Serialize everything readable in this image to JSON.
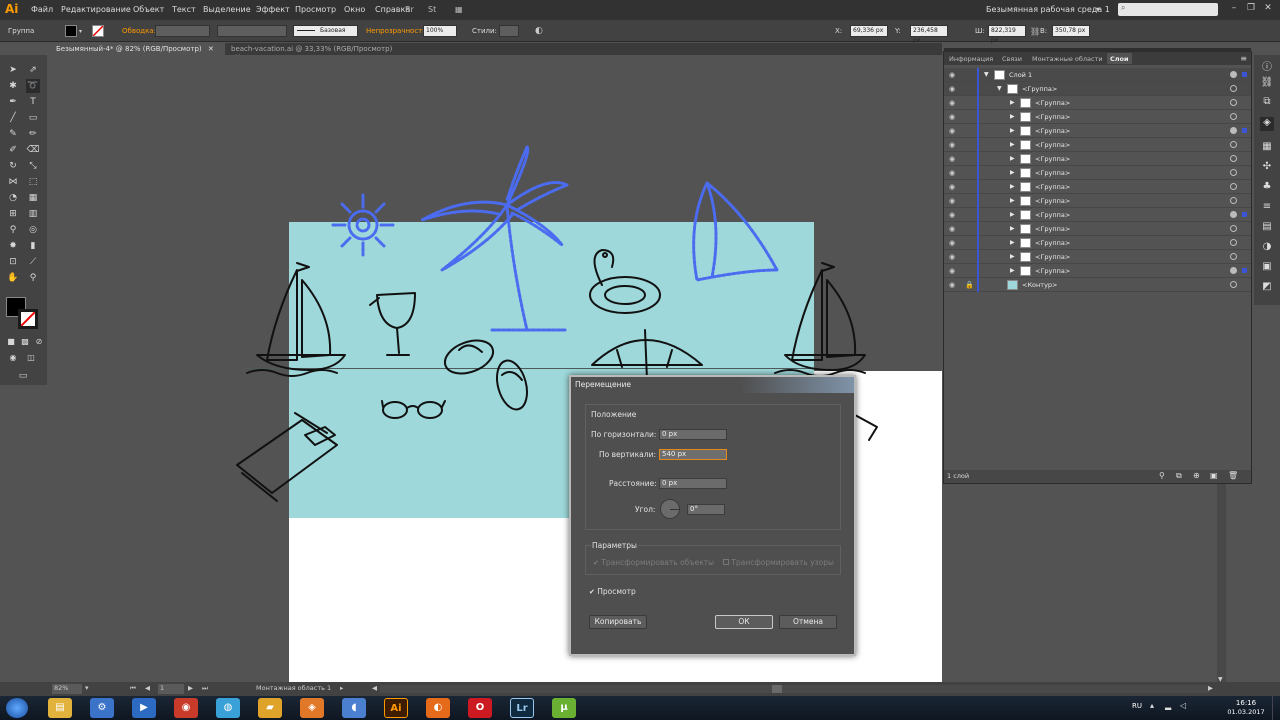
{
  "menubar": {
    "logo": "Ai",
    "items": [
      "Файл",
      "Редактирование",
      "Объект",
      "Текст",
      "Выделение",
      "Эффект",
      "Просмотр",
      "Окно",
      "Справка"
    ],
    "workspace": "Безымянная рабочая среда 1"
  },
  "controlbar": {
    "selection_label": "Группа",
    "stroke_label": "Обводка:",
    "stroke_style": "Базовая",
    "opacity_label": "Непрозрачность:",
    "opacity_value": "100%",
    "styles_label": "Стили:",
    "x_label": "X:",
    "x_value": "69,336 px",
    "y_label": "Y:",
    "y_value": "236,458 px",
    "w_label": "Ш:",
    "w_value": "822,319 px",
    "h_label": "В:",
    "h_value": "350,78 px"
  },
  "tabs": [
    {
      "label": "Безымянный-4* @ 82% (RGB/Просмотр)",
      "active": true
    },
    {
      "label": "beach-vacation.ai @ 33,33% (RGB/Просмотр)",
      "active": false
    }
  ],
  "layers_panel": {
    "tabs": [
      "Информация",
      "Связи",
      "Монтажные области",
      "Слои"
    ],
    "active_tab": "Слои",
    "rows": [
      {
        "label": "Слой 1",
        "indent": 0,
        "expanded": true,
        "target": "filled"
      },
      {
        "label": "<Группа>",
        "indent": 1,
        "expanded": true,
        "target": "ring"
      },
      {
        "label": "<Группа>",
        "indent": 2,
        "target": "ring"
      },
      {
        "label": "<Группа>",
        "indent": 2,
        "target": "ring"
      },
      {
        "label": "<Группа>",
        "indent": 2,
        "target": "filled"
      },
      {
        "label": "<Группа>",
        "indent": 2,
        "target": "ring"
      },
      {
        "label": "<Группа>",
        "indent": 2,
        "target": "ring"
      },
      {
        "label": "<Группа>",
        "indent": 2,
        "target": "ring"
      },
      {
        "label": "<Группа>",
        "indent": 2,
        "target": "ring"
      },
      {
        "label": "<Группа>",
        "indent": 2,
        "target": "ring"
      },
      {
        "label": "<Группа>",
        "indent": 2,
        "target": "filled"
      },
      {
        "label": "<Группа>",
        "indent": 2,
        "target": "ring"
      },
      {
        "label": "<Группа>",
        "indent": 2,
        "target": "ring"
      },
      {
        "label": "<Группа>",
        "indent": 2,
        "target": "ring"
      },
      {
        "label": "<Группа>",
        "indent": 2,
        "target": "filled"
      },
      {
        "label": "<Контур>",
        "indent": 1,
        "locked": true,
        "target": "ring"
      }
    ],
    "footer": "1 слой"
  },
  "dialog": {
    "title": "Перемещение",
    "position_group": "Положение",
    "horizontal_label": "По горизонтали:",
    "horizontal_value": "0 px",
    "vertical_label": "По вертикали:",
    "vertical_value": "540 px",
    "distance_label": "Расстояние:",
    "distance_value": "0 px",
    "angle_label": "Угол:",
    "angle_value": "0°",
    "params_group": "Параметры",
    "transform_objects": "Трансформировать объекты",
    "transform_patterns": "Трансформировать узоры",
    "preview_label": "Просмотр",
    "preview_checked": true,
    "copy_button": "Копировать",
    "ok_button": "ОК",
    "cancel_button": "Отмена"
  },
  "statusbar": {
    "zoom": "82%",
    "page": "1",
    "artboard_label": "Монтажная область 1"
  },
  "taskbar": {
    "lang": "RU",
    "time": "16:16",
    "date": "01.03.2017",
    "apps": [
      {
        "name": "explorer-icon",
        "glyph": "▤",
        "color": "#e2b33c"
      },
      {
        "name": "settings-icon",
        "glyph": "⚙",
        "color": "#3b73c8"
      },
      {
        "name": "media-icon",
        "glyph": "▶",
        "color": "#2d6bc2"
      },
      {
        "name": "ccleaner-icon",
        "glyph": "◉",
        "color": "#c83a2a"
      },
      {
        "name": "network-icon",
        "glyph": "◍",
        "color": "#3aa0d8"
      },
      {
        "name": "folder-icon",
        "glyph": "▰",
        "color": "#e0a32a"
      },
      {
        "name": "app-icon",
        "glyph": "◈",
        "color": "#e07828"
      },
      {
        "name": "audio-icon",
        "glyph": "◖",
        "color": "#4b7fd0"
      },
      {
        "name": "illustrator-icon",
        "glyph": "Ai",
        "color": "#3d1c00"
      },
      {
        "name": "firefox-icon",
        "glyph": "◐",
        "color": "#e56a19"
      },
      {
        "name": "opera-icon",
        "glyph": "O",
        "color": "#cc1a22"
      },
      {
        "name": "lightroom-icon",
        "glyph": "Lr",
        "color": "#0f2a3e"
      },
      {
        "name": "utorrent-icon",
        "glyph": "µ",
        "color": "#6ab032"
      }
    ]
  },
  "colors": {
    "artboard_teal": "#9ed8da",
    "selection_blue": "#4b6cf0",
    "accent_orange": "#ff9a00"
  }
}
